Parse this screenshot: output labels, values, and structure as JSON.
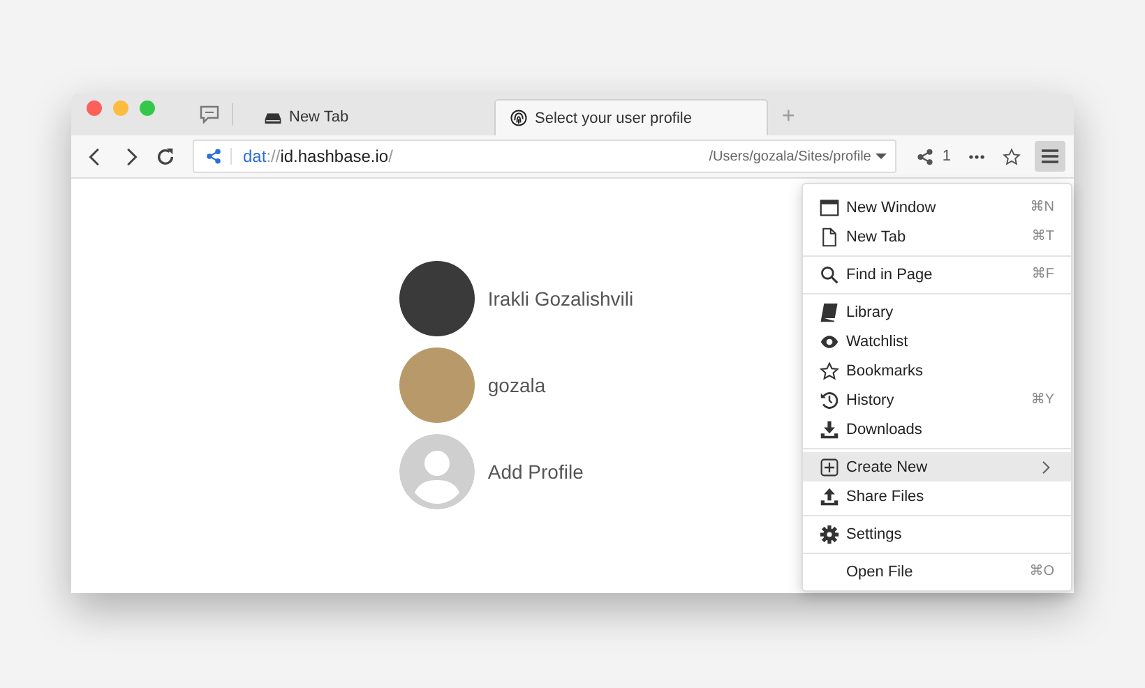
{
  "tabs": [
    {
      "label": "New Tab",
      "selected": false
    },
    {
      "label": "Select your user profile",
      "selected": true
    }
  ],
  "new_tab_button": "+",
  "address": {
    "scheme": "dat",
    "separator": "://",
    "host": "id.hashbase.io",
    "trailing": "/",
    "path": "/Users/gozala/Sites/profile",
    "peers": "1"
  },
  "profiles": [
    {
      "name": "Irakli Gozalishvili",
      "kind": "photo",
      "color": "#3a3a3a"
    },
    {
      "name": "gozala",
      "kind": "photo",
      "color": "#b89a6a"
    },
    {
      "name": "Add Profile",
      "kind": "add"
    }
  ],
  "menu": [
    [
      {
        "label": "New Window",
        "shortcut": "⌘N",
        "highlighted": false,
        "submenu": false
      },
      {
        "label": "New Tab",
        "shortcut": "⌘T",
        "highlighted": false,
        "submenu": false
      }
    ],
    [
      {
        "label": "Find in Page",
        "shortcut": "⌘F",
        "highlighted": false,
        "submenu": false
      }
    ],
    [
      {
        "label": "Library",
        "highlighted": false,
        "submenu": false
      },
      {
        "label": "Watchlist",
        "highlighted": false,
        "submenu": false
      },
      {
        "label": "Bookmarks",
        "highlighted": false,
        "submenu": false
      },
      {
        "label": "History",
        "shortcut": "⌘Y",
        "highlighted": false,
        "submenu": false
      },
      {
        "label": "Downloads",
        "highlighted": false,
        "submenu": false
      }
    ],
    [
      {
        "label": "Create New",
        "highlighted": true,
        "submenu": true
      },
      {
        "label": "Share Files",
        "highlighted": false,
        "submenu": false
      }
    ],
    [
      {
        "label": "Settings",
        "highlighted": false,
        "submenu": false
      }
    ],
    [
      {
        "label": "Open File",
        "shortcut": "⌘O",
        "highlighted": false,
        "submenu": false
      }
    ]
  ]
}
